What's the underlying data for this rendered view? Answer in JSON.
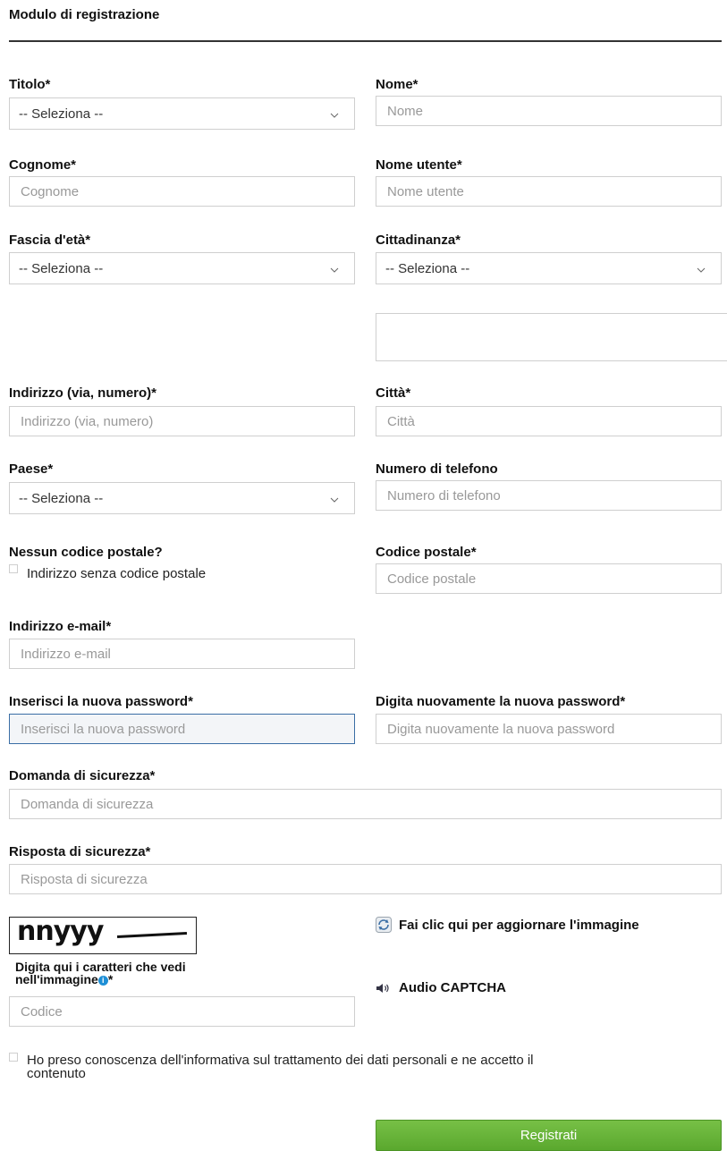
{
  "form": {
    "title": "Modulo di registrazione",
    "labels": {
      "titolo": "Titolo*",
      "nome": "Nome*",
      "cognome": "Cognome*",
      "nome_utente": "Nome utente*",
      "fascia_eta": "Fascia d'età*",
      "cittadinanza": "Cittadinanza*",
      "indirizzo": "Indirizzo (via, numero)*",
      "citta": "Città*",
      "paese": "Paese*",
      "telefono": "Numero di telefono",
      "nessun_cap": "Nessun codice postale?",
      "cap": "Codice postale*",
      "email": "Indirizzo e-mail*",
      "password": "Inserisci la nuova password*",
      "password2": "Digita nuovamente la nuova password*",
      "domanda": "Domanda di sicurezza*",
      "risposta": "Risposta di sicurezza*",
      "captcha_line1": "Digita qui i caratteri che vedi",
      "captcha_line2": "nell'immagine",
      "captcha_star": "*"
    },
    "placeholders": {
      "nome": "Nome",
      "cognome": "Cognome",
      "nome_utente": "Nome utente",
      "indirizzo": "Indirizzo (via, numero)",
      "citta": "Città",
      "telefono": "Numero di telefono",
      "cap": "Codice postale",
      "email": "Indirizzo e-mail",
      "password": "Inserisci la nuova password",
      "password2": "Digita nuovamente la nuova password",
      "domanda": "Domanda di sicurezza",
      "risposta": "Risposta di sicurezza",
      "codice": "Codice"
    },
    "selects": {
      "titolo": "-- Seleziona --",
      "fascia_eta": "-- Seleziona --",
      "cittadinanza": "-- Seleziona --",
      "paese": "-- Seleziona --"
    },
    "checkboxes": {
      "no_cap": "Indirizzo senza codice postale",
      "privacy_line1": "Ho preso conoscenza dell'informativa sul trattamento dei dati personali e ne accetto il",
      "privacy_line2": "contenuto"
    },
    "captcha": {
      "image_text": "nnyyy",
      "refresh_label": "Fai clic qui per aggiornare l'immagine",
      "audio_label": "Audio CAPTCHA"
    },
    "submit_label": "Registrati",
    "colors": {
      "submit_green": "#62b038",
      "active_border": "#3a6ea5",
      "info_blue": "#1e8fd6"
    }
  }
}
